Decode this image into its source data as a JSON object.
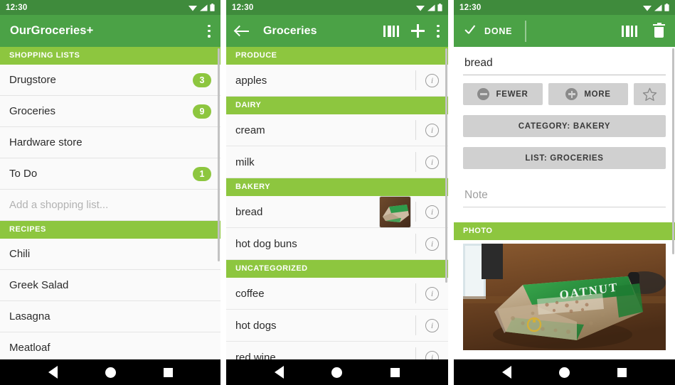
{
  "status_bar": {
    "time": "12:30",
    "icons": [
      "wifi-icon",
      "signal-icon",
      "battery-icon"
    ]
  },
  "colors": {
    "appbar_green": "#4BA246",
    "appbar_green_dark": "#3F8B3C",
    "section_green": "#8DC63F",
    "badge_green": "#8DC63F",
    "row_bg": "#FAFAFA",
    "button_gray": "#D0D0D0"
  },
  "navbar": {
    "back": "back-triangle",
    "home": "home-circle",
    "recents": "recents-square"
  },
  "panel1": {
    "title": "OurGroceries+",
    "overflow_icon": "kebab-menu-icon",
    "sections": [
      {
        "header": "SHOPPING LISTS",
        "rows": [
          {
            "label": "Drugstore",
            "badge": "3"
          },
          {
            "label": "Groceries",
            "badge": "9"
          },
          {
            "label": "Hardware store",
            "badge": ""
          },
          {
            "label": "To Do",
            "badge": "1"
          },
          {
            "label": "Add a shopping list...",
            "badge": "",
            "placeholder": true
          }
        ]
      },
      {
        "header": "RECIPES",
        "rows": [
          {
            "label": "Chili",
            "badge": ""
          },
          {
            "label": "Greek Salad",
            "badge": ""
          },
          {
            "label": "Lasagna",
            "badge": ""
          },
          {
            "label": "Meatloaf",
            "badge": ""
          }
        ]
      }
    ]
  },
  "panel2": {
    "title": "Groceries",
    "back_icon": "back-arrow-icon",
    "actions": [
      "barcode-scan-icon",
      "add-item-icon",
      "kebab-menu-icon"
    ],
    "sections": [
      {
        "header": "PRODUCE",
        "items": [
          {
            "label": "apples",
            "thumb": false
          }
        ]
      },
      {
        "header": "DAIRY",
        "items": [
          {
            "label": "cream",
            "thumb": false
          },
          {
            "label": "milk",
            "thumb": false
          }
        ]
      },
      {
        "header": "BAKERY",
        "items": [
          {
            "label": "bread",
            "thumb": true
          },
          {
            "label": "hot dog buns",
            "thumb": false
          }
        ]
      },
      {
        "header": "UNCATEGORIZED",
        "items": [
          {
            "label": "coffee",
            "thumb": false
          },
          {
            "label": "hot dogs",
            "thumb": false
          },
          {
            "label": "red wine",
            "thumb": false
          }
        ]
      }
    ],
    "info_icon": "info-icon"
  },
  "panel3": {
    "done_label": "DONE",
    "done_icon": "checkmark-icon",
    "actions": [
      "barcode-scan-icon",
      "delete-trash-icon"
    ],
    "item_name": "bread",
    "fewer_label": "FEWER",
    "more_label": "MORE",
    "favorite_icon": "star-outline-icon",
    "category_label": "CATEGORY: BAKERY",
    "list_label": "LIST: GROCERIES",
    "note_placeholder": "Note",
    "photo_header": "PHOTO",
    "photo_alt": "oatnut-bread-loaf-photo"
  }
}
